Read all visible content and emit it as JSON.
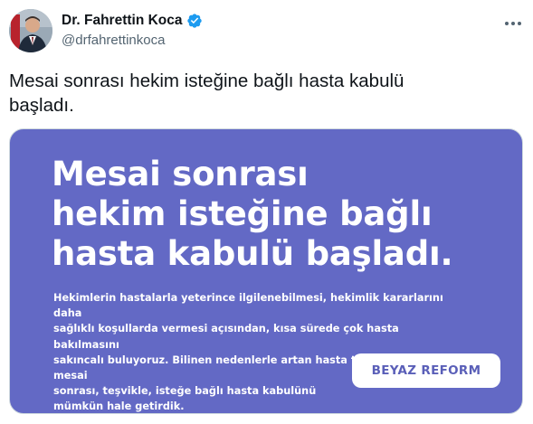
{
  "author": {
    "display_name": "Dr. Fahrettin Koca",
    "handle": "@drfahrettinkoca",
    "verified_badge_icon": "verified-badge-icon",
    "verified_color": "#1d9bf0"
  },
  "menu": {
    "icon": "more-horizontal-icon"
  },
  "tweet": {
    "text_line1": "Mesai sonrası hekim isteğine bağlı hasta kabulü",
    "text_line2": "başladı."
  },
  "media": {
    "background_color": "#6369c5",
    "headline_line1": "Mesai sonrası",
    "headline_line2": "hekim isteğine bağlı",
    "headline_line3": "hasta kabulü başladı.",
    "body_line1": "Hekimlerin hastalarla yeterince ilgilenebilmesi, hekimlik kararlarını daha",
    "body_line2": "sağlıklı koşullarda vermesi açısından, kısa sürede çok hasta bakılmasını",
    "body_line3": "sakıncalı buluyoruz. Bilinen nedenlerle artan hasta talebi içinse mesai",
    "body_line4": "sonrası, teşvikle, isteğe bağlı hasta kabulünü",
    "body_line5": "mümkün hale getirdik.",
    "badge_label": "BEYAZ REFORM"
  }
}
